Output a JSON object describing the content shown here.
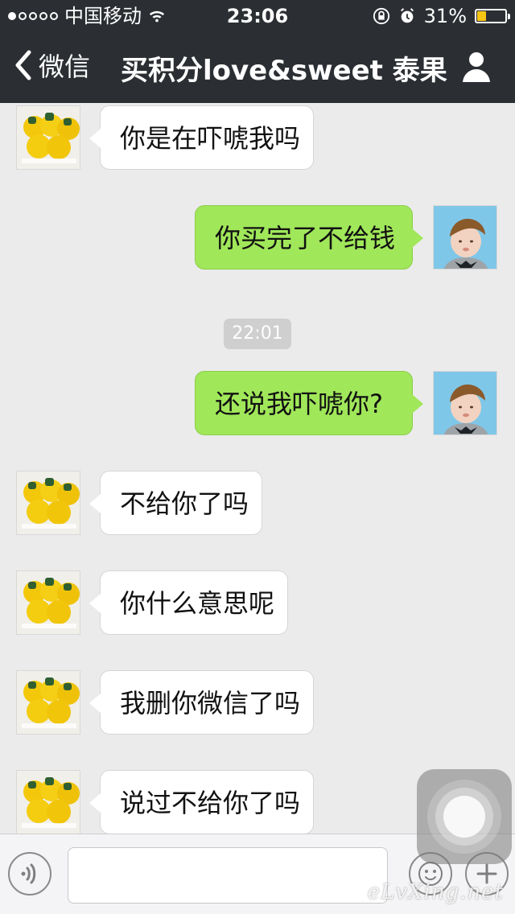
{
  "status": {
    "carrier": "中国移动",
    "time": "23:06",
    "battery": "31%",
    "battery_level": 0.31,
    "signal_filled": 1,
    "signal_total": 5
  },
  "nav": {
    "back_label": "微信",
    "title": "买积分love&sweet 泰果"
  },
  "chat": {
    "messages": [
      {
        "side": "in",
        "text": "你是在吓唬我吗",
        "avatar": "mango-avatar"
      },
      {
        "side": "out",
        "text": "你买完了不给钱",
        "avatar": "child-avatar"
      },
      {
        "side": "out",
        "text": "还说我吓唬你?",
        "avatar": "child-avatar"
      },
      {
        "side": "in",
        "text": "不给你了吗",
        "avatar": "mango-avatar"
      },
      {
        "side": "in",
        "text": "你什么意思呢",
        "avatar": "mango-avatar"
      },
      {
        "side": "in",
        "text": "我删你微信了吗",
        "avatar": "mango-avatar"
      },
      {
        "side": "in",
        "text": "说过不给你了吗",
        "avatar": "mango-avatar"
      }
    ],
    "timestamp": "22:01"
  },
  "input": {
    "placeholder": "",
    "value": ""
  },
  "watermark": "eLvXing.net",
  "colors": {
    "navbar": "#2b2f33",
    "chat_bg": "#ebebeb",
    "incoming_bubble": "#ffffff",
    "outgoing_bubble": "#a0e75a",
    "battery_fill": "#f7c514"
  }
}
